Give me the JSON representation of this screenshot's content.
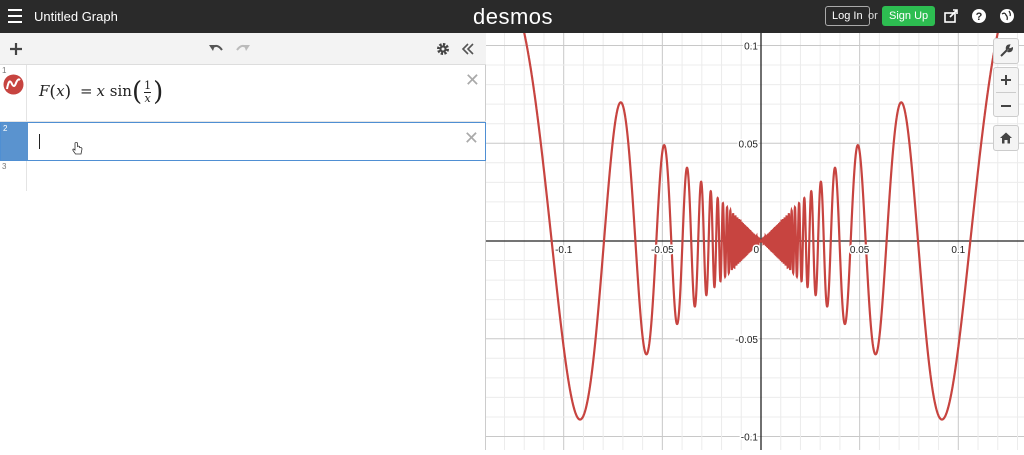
{
  "topbar": {
    "title": "Untitled Graph",
    "logo": "desmos",
    "login_label": "Log In",
    "or_text": "or",
    "signup_label": "Sign Up",
    "signup_color": "#2dbd51"
  },
  "expressions": [
    {
      "index": "1",
      "lhs": "F",
      "var": "x",
      "rhs_coef": "x",
      "func": "sin",
      "frac_num": "1",
      "frac_den": "x",
      "color": "#c74440"
    },
    {
      "index": "2",
      "value": ""
    },
    {
      "index": "3",
      "value": ""
    }
  ],
  "graph": {
    "curve_color": "#c74440",
    "function": "x*sin(1/x)",
    "x_ticks": [
      "-0.1",
      "-0.05",
      "0",
      "0.05",
      "0.1"
    ],
    "y_ticks": [
      "0.1",
      "0.05",
      "-0.05",
      "-0.1"
    ]
  },
  "icons": [
    "menu-icon",
    "share-icon",
    "help-icon",
    "globe-icon",
    "add-icon",
    "undo-icon",
    "redo-icon",
    "settings-icon",
    "collapse-icon",
    "wrench-icon",
    "zoom-in-icon",
    "zoom-out-icon",
    "home-icon"
  ]
}
